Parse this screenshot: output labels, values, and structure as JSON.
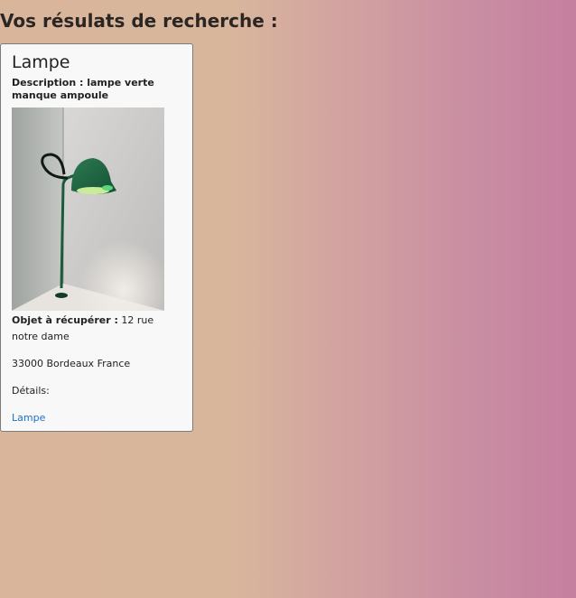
{
  "page": {
    "heading": "Vos résulats de recherche :"
  },
  "results": [
    {
      "title": "Lampe",
      "description_label": "Description :",
      "description": "lampe verte manque ampoule",
      "pickup_label": "Objet à récupérer :",
      "address_line1": "12 rue notre dame",
      "address_line2": "33000 Bordeaux France",
      "details_label": "Détails:",
      "link_text": "Lampe",
      "colors": {
        "lamp": "#1c5a3a",
        "link": "#1f6fc4"
      }
    }
  ]
}
